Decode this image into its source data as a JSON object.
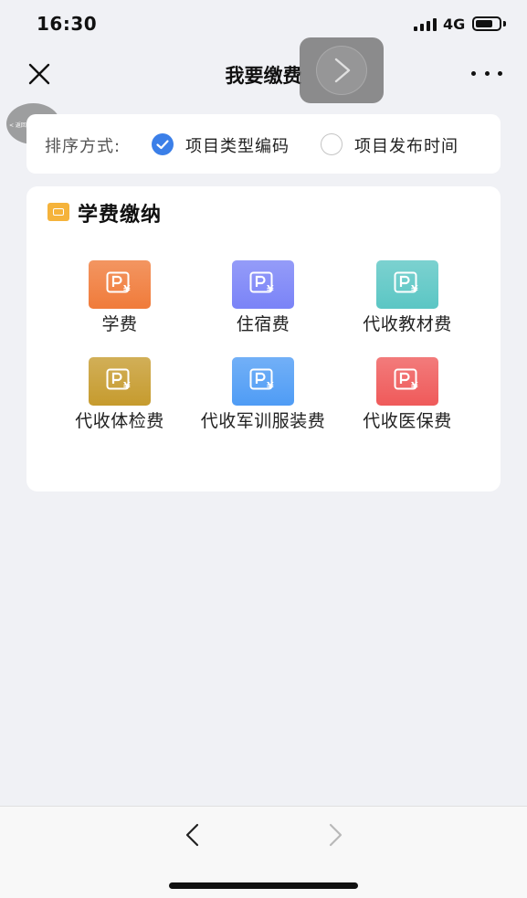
{
  "status_bar": {
    "time": "16:30",
    "network": "4G",
    "battery_level": 0.75
  },
  "nav": {
    "title": "我要缴费",
    "close_icon": "close-icon",
    "more_icon": "more-icon"
  },
  "float_back": {
    "label": "< 返回"
  },
  "sort": {
    "label": "排序方式:",
    "options": [
      {
        "label": "项目类型编码",
        "selected": true
      },
      {
        "label": "项目发布时间",
        "selected": false
      }
    ]
  },
  "fees": {
    "title": "学费缴纳",
    "items": [
      {
        "label": "学费",
        "color": "#f07b3a"
      },
      {
        "label": "住宿费",
        "color": "#7a83f7"
      },
      {
        "label": "代收教材费",
        "color": "#5bc6c4"
      },
      {
        "label": "代收体检费",
        "color": "#c69b2e"
      },
      {
        "label": "代收军训服装费",
        "color": "#4f9cf5"
      },
      {
        "label": "代收医保费",
        "color": "#ef5a5a"
      }
    ]
  },
  "bottom": {
    "back_icon": "chevron-left-icon",
    "forward_icon": "chevron-right-icon"
  }
}
